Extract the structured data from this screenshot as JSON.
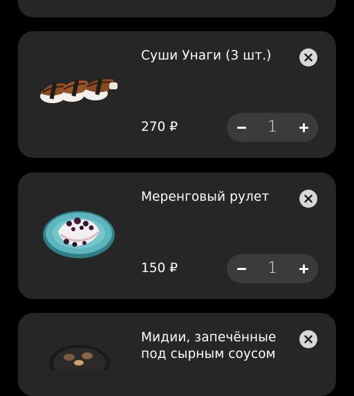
{
  "cart": {
    "items": [
      {
        "title": "",
        "price": "",
        "quantity": ""
      },
      {
        "title": "Суши Унаги (3 шт.)",
        "price": "270 ₽",
        "quantity": "1",
        "image_icon": "unagi-sushi-image"
      },
      {
        "title": "Меренговый рулет",
        "price": "150 ₽",
        "quantity": "1",
        "image_icon": "meringue-roll-image"
      },
      {
        "title": "Мидии, запечённые под сырным соусом",
        "price": "",
        "quantity": "",
        "image_icon": "baked-mussels-image"
      }
    ]
  },
  "colors": {
    "background": "#000000",
    "card": "#262626",
    "stepper": "#3b3b3b",
    "remove_button": "#d8d8d8"
  }
}
